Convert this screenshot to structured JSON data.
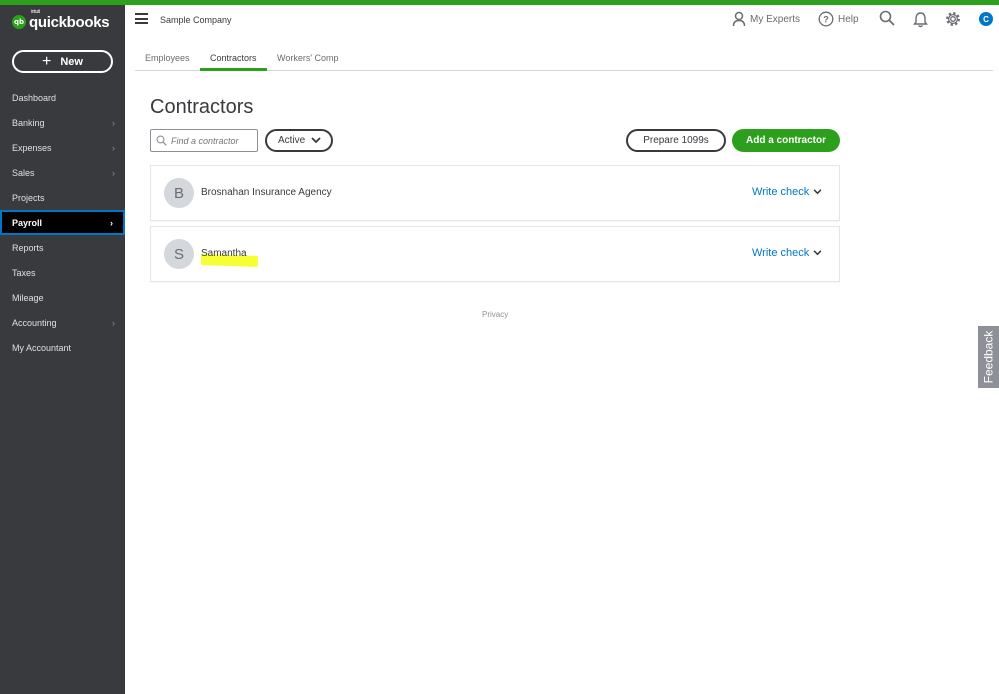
{
  "brand": {
    "logo_prefix": "intuit",
    "logo_name": "quickbooks",
    "accent": "#2ca01c",
    "link": "#0077c5"
  },
  "sidebar": {
    "new_label": "New",
    "items": [
      {
        "label": "Dashboard",
        "chevron": false
      },
      {
        "label": "Banking",
        "chevron": true
      },
      {
        "label": "Expenses",
        "chevron": true
      },
      {
        "label": "Sales",
        "chevron": true
      },
      {
        "label": "Projects",
        "chevron": false
      },
      {
        "label": "Payroll",
        "chevron": true,
        "active": true
      },
      {
        "label": "Reports",
        "chevron": false
      },
      {
        "label": "Taxes",
        "chevron": false
      },
      {
        "label": "Mileage",
        "chevron": false
      },
      {
        "label": "Accounting",
        "chevron": true
      },
      {
        "label": "My Accountant",
        "chevron": false
      }
    ]
  },
  "header": {
    "company": "Sample Company",
    "my_experts": "My Experts",
    "help": "Help",
    "user_initial": "C"
  },
  "tabs": [
    {
      "label": "Employees"
    },
    {
      "label": "Contractors",
      "active": true
    },
    {
      "label": "Workers' Comp"
    }
  ],
  "page": {
    "title": "Contractors",
    "search_placeholder": "Find a contractor",
    "status_filter": "Active",
    "prepare_label": "Prepare 1099s",
    "add_label": "Add a contractor"
  },
  "contractors": [
    {
      "initial": "B",
      "name": "Brosnahan Insurance Agency",
      "action": "Write check",
      "highlighted": false
    },
    {
      "initial": "S",
      "name": "Samantha",
      "action": "Write check",
      "highlighted": true
    }
  ],
  "footer": {
    "privacy": "Privacy"
  },
  "feedback_label": "Feedback"
}
